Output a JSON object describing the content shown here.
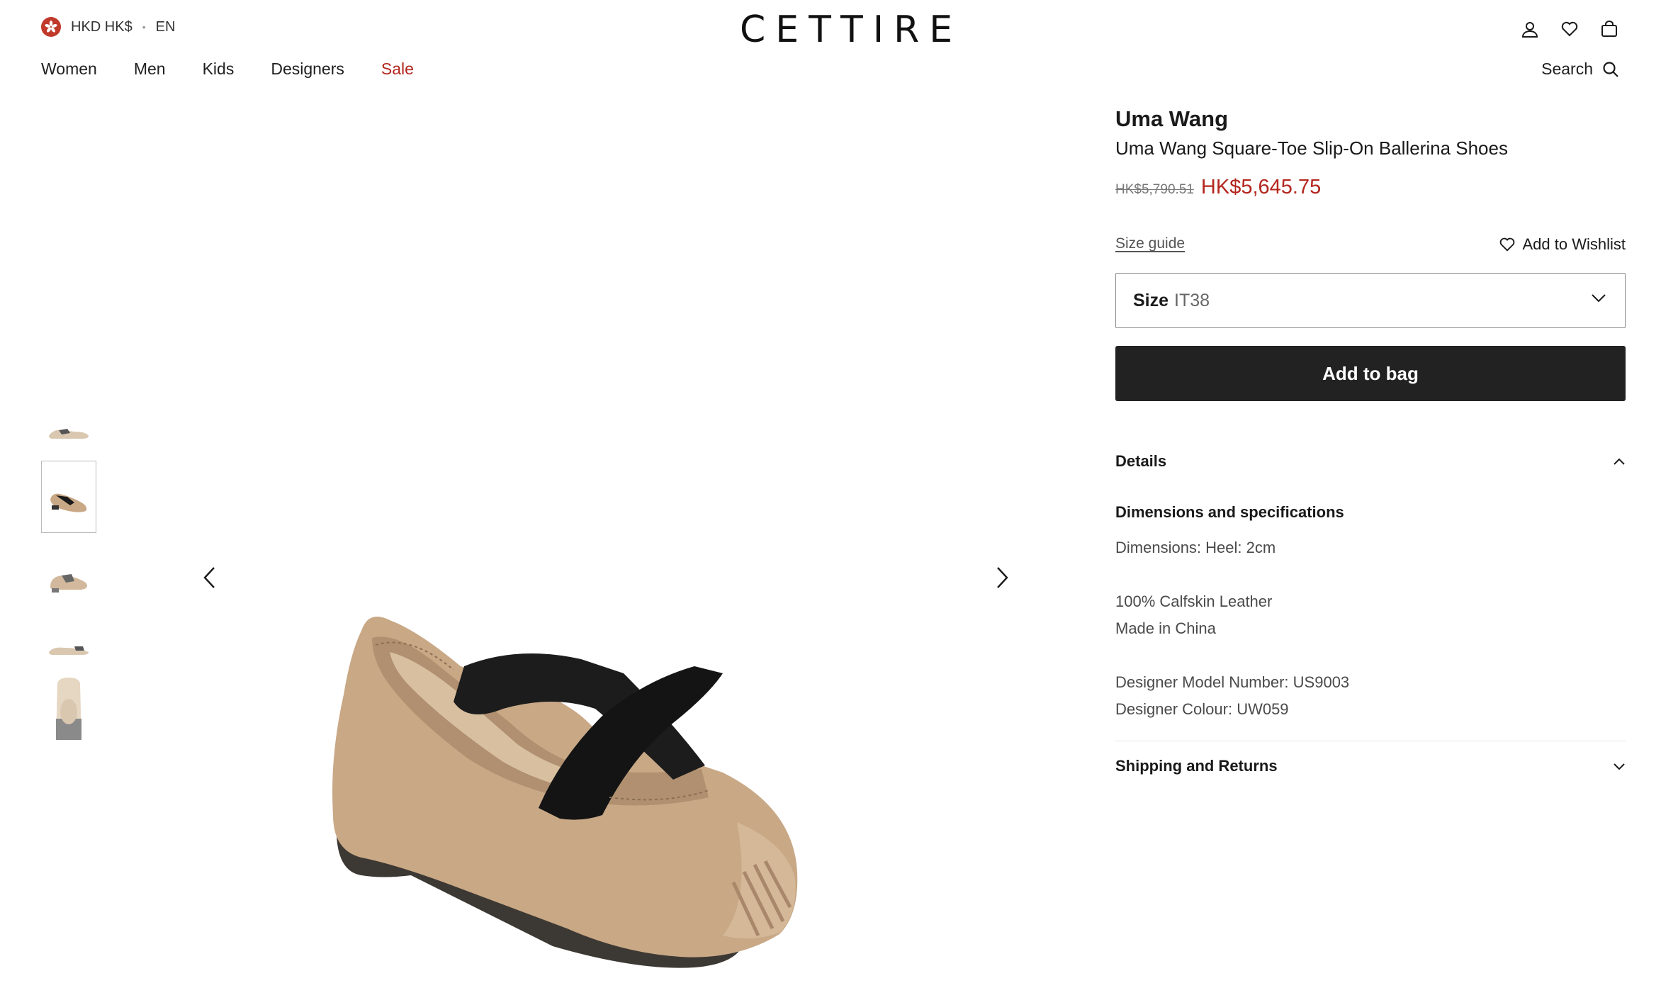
{
  "header": {
    "currency": "HKD HK$",
    "language": "EN",
    "logo": "CETTIRE",
    "icons": [
      "account-icon",
      "heart-icon",
      "bag-icon"
    ]
  },
  "nav": {
    "items": [
      "Women",
      "Men",
      "Kids",
      "Designers"
    ],
    "sale": "Sale",
    "search": "Search"
  },
  "product": {
    "brand": "Uma Wang",
    "name": "Uma Wang Square-Toe Slip-On Ballerina Shoes",
    "old_price": "HK$5,790.51",
    "price": "HK$5,645.75",
    "size_guide": "Size guide",
    "wishlist": "Add to Wishlist",
    "size_label": "Size",
    "size_value": "IT38",
    "add_to_bag": "Add to bag"
  },
  "details": {
    "title": "Details",
    "spec_title": "Dimensions and specifications",
    "lines": [
      "Dimensions: Heel: 2cm",
      "100% Calfskin Leather",
      "Made in China",
      "Designer Model Number: US9003",
      "Designer Colour: UW059"
    ]
  },
  "shipping": {
    "title": "Shipping and Returns"
  },
  "colors": {
    "sale": "#b3261e",
    "button": "#222222",
    "shoe_leather": "#c9a886",
    "elastic": "#1a1a1a"
  }
}
